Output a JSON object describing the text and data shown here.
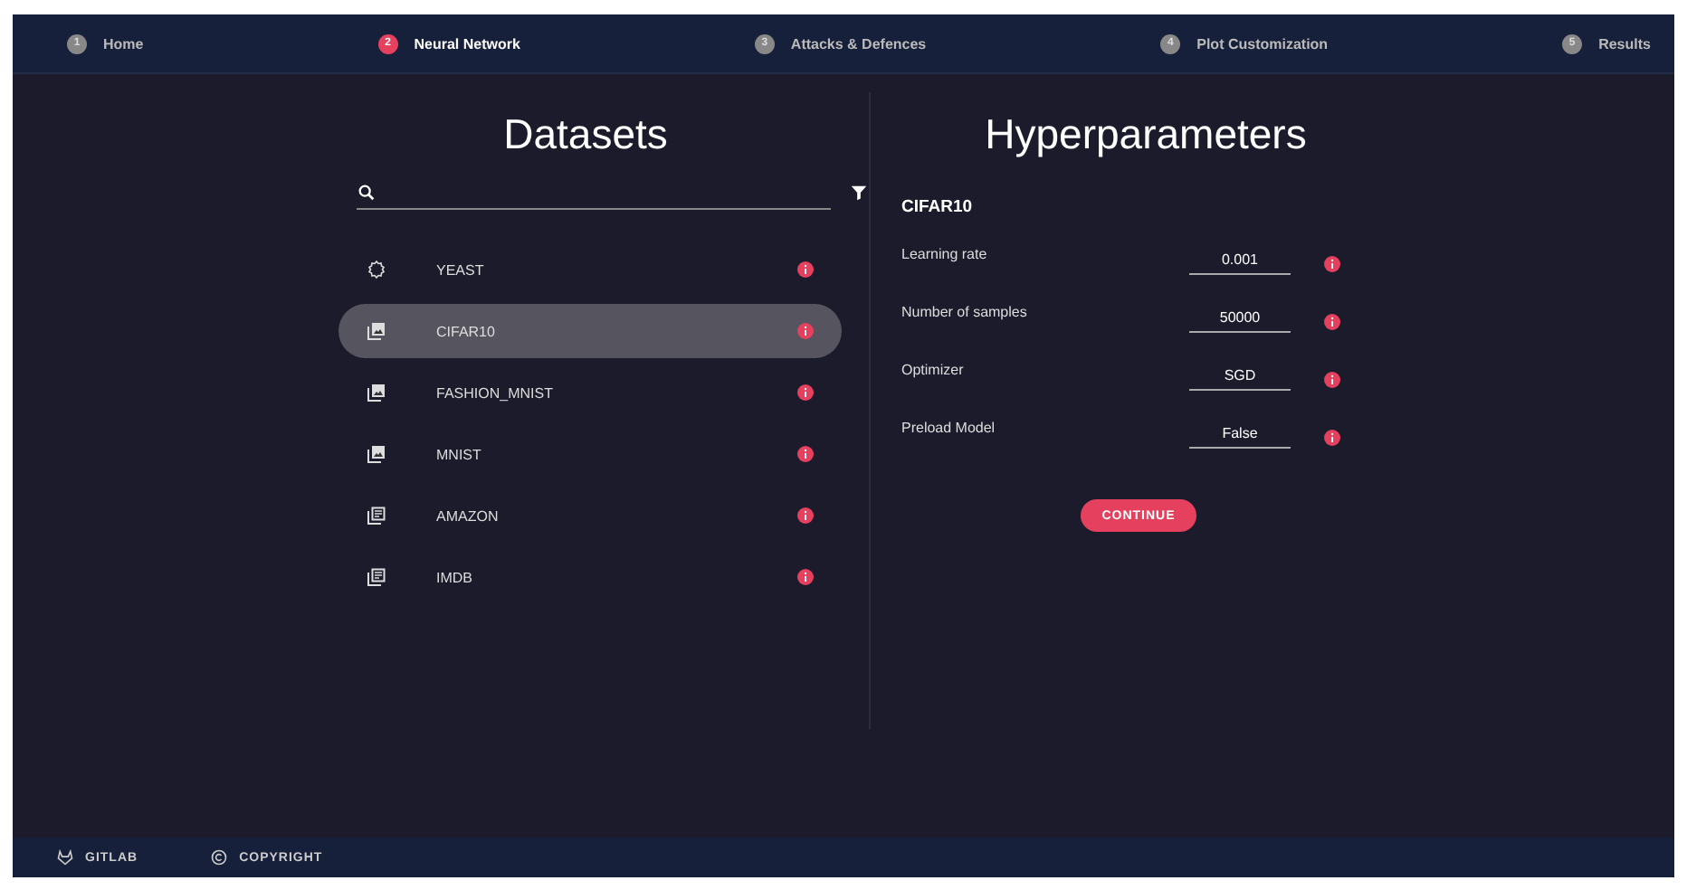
{
  "steps": [
    {
      "number": "1",
      "label": "Home",
      "selected": false
    },
    {
      "number": "2",
      "label": "Neural Network",
      "selected": true
    },
    {
      "number": "3",
      "label": "Attacks & Defences",
      "selected": false
    },
    {
      "number": "4",
      "label": "Plot Customization",
      "selected": false
    },
    {
      "number": "5",
      "label": "Results",
      "selected": false
    }
  ],
  "datasets": {
    "title": "Datasets",
    "items": [
      {
        "name": "YEAST",
        "kind": "gear",
        "selected": false
      },
      {
        "name": "CIFAR10",
        "kind": "image",
        "selected": true
      },
      {
        "name": "FASHION_MNIST",
        "kind": "image",
        "selected": false
      },
      {
        "name": "MNIST",
        "kind": "image",
        "selected": false
      },
      {
        "name": "AMAZON",
        "kind": "text",
        "selected": false
      },
      {
        "name": "IMDB",
        "kind": "text",
        "selected": false
      }
    ]
  },
  "hyperparameters": {
    "title": "Hyperparameters",
    "dataset": "CIFAR10",
    "params": [
      {
        "label": "Learning rate",
        "value": "0.001"
      },
      {
        "label": "Number of samples",
        "value": "50000"
      },
      {
        "label": "Optimizer",
        "value": "SGD"
      },
      {
        "label": "Preload Model",
        "value": "False"
      }
    ],
    "button": "CONTINUE"
  },
  "footer": [
    {
      "label": "GITLAB",
      "kind": "gitlab"
    },
    {
      "label": "COPYRIGHT",
      "kind": "copyright"
    }
  ]
}
